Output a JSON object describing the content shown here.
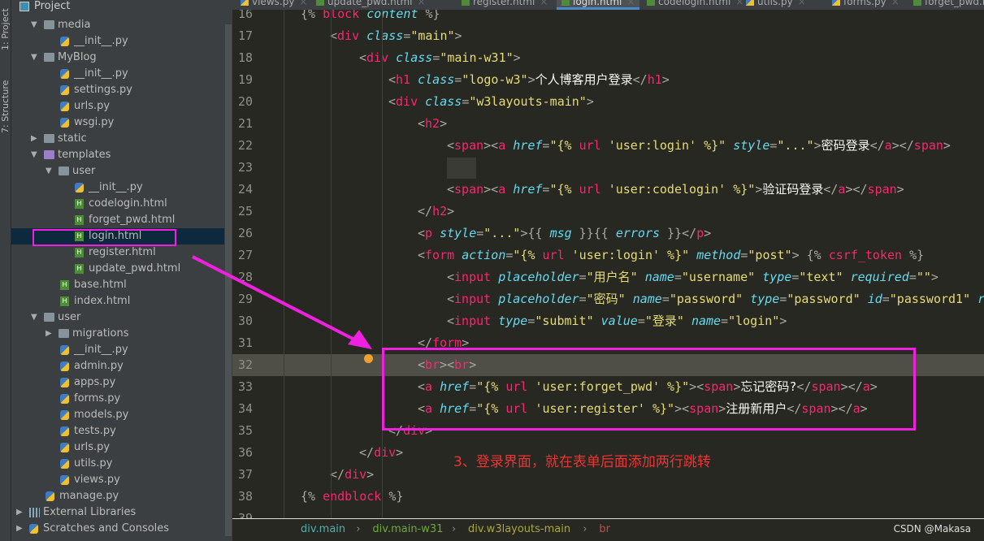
{
  "tool_strip": {
    "project": "1: Project",
    "structure": "7: Structure"
  },
  "sidebar": {
    "title": "Project",
    "items": [
      {
        "label": "media",
        "type": "folder",
        "level": 1,
        "expanded": true
      },
      {
        "label": "__init__.py",
        "type": "py",
        "level": 2
      },
      {
        "label": "MyBlog",
        "type": "folder",
        "level": 1,
        "expanded": true
      },
      {
        "label": "__init__.py",
        "type": "py",
        "level": 2
      },
      {
        "label": "settings.py",
        "type": "py",
        "level": 2
      },
      {
        "label": "urls.py",
        "type": "py",
        "level": 2
      },
      {
        "label": "wsgi.py",
        "type": "py",
        "level": 2
      },
      {
        "label": "static",
        "type": "folder",
        "level": 1,
        "expanded": false
      },
      {
        "label": "templates",
        "type": "folder-purple",
        "level": 1,
        "expanded": true
      },
      {
        "label": "user",
        "type": "folder",
        "level": 2,
        "expanded": true
      },
      {
        "label": "__init__.py",
        "type": "py",
        "level": 3
      },
      {
        "label": "codelogin.html",
        "type": "html",
        "level": 3
      },
      {
        "label": "forget_pwd.html",
        "type": "html",
        "level": 3
      },
      {
        "label": "login.html",
        "type": "html",
        "level": 3,
        "selected": true
      },
      {
        "label": "register.html",
        "type": "html",
        "level": 3
      },
      {
        "label": "update_pwd.html",
        "type": "html",
        "level": 3
      },
      {
        "label": "base.html",
        "type": "html",
        "level": 2
      },
      {
        "label": "index.html",
        "type": "html",
        "level": 2
      },
      {
        "label": "user",
        "type": "folder",
        "level": 1,
        "expanded": true
      },
      {
        "label": "migrations",
        "type": "folder",
        "level": 2,
        "expanded": false
      },
      {
        "label": "__init__.py",
        "type": "py",
        "level": 2
      },
      {
        "label": "admin.py",
        "type": "py",
        "level": 2
      },
      {
        "label": "apps.py",
        "type": "py",
        "level": 2
      },
      {
        "label": "forms.py",
        "type": "py",
        "level": 2
      },
      {
        "label": "models.py",
        "type": "py",
        "level": 2
      },
      {
        "label": "tests.py",
        "type": "py",
        "level": 2
      },
      {
        "label": "urls.py",
        "type": "py",
        "level": 2
      },
      {
        "label": "utils.py",
        "type": "py",
        "level": 2
      },
      {
        "label": "views.py",
        "type": "py",
        "level": 2
      },
      {
        "label": "manage.py",
        "type": "py",
        "level": 1
      },
      {
        "label": "External Libraries",
        "type": "lib",
        "level": 0,
        "expanded": false
      },
      {
        "label": "Scratches and Consoles",
        "type": "scratch",
        "level": 0,
        "expanded": false
      }
    ]
  },
  "tabs": [
    {
      "label": "views.py",
      "type": "py"
    },
    {
      "label": "update_pwd.html",
      "type": "html"
    },
    {
      "label": "register.html",
      "type": "html"
    },
    {
      "label": "login.html",
      "type": "html",
      "active": true
    },
    {
      "label": "codelogin.html",
      "type": "html"
    },
    {
      "label": "utils.py",
      "type": "py"
    },
    {
      "label": "forms.py",
      "type": "py"
    },
    {
      "label": "forget_pwd.htm",
      "type": "html"
    }
  ],
  "code": [
    {
      "n": "16",
      "i": 0,
      "tok": [
        [
          "p",
          "{% "
        ],
        [
          "k",
          "block "
        ],
        [
          "a",
          "content"
        ],
        [
          "p",
          " %}"
        ]
      ]
    },
    {
      "n": "17",
      "i": 1,
      "tok": [
        [
          "p",
          "<"
        ],
        [
          "t",
          "div "
        ],
        [
          "a",
          "class"
        ],
        [
          "p",
          "="
        ],
        [
          "s",
          "\"main\""
        ],
        [
          "p",
          ">"
        ]
      ]
    },
    {
      "n": "18",
      "i": 2,
      "tok": [
        [
          "p",
          "<"
        ],
        [
          "t",
          "div "
        ],
        [
          "a",
          "class"
        ],
        [
          "p",
          "="
        ],
        [
          "s",
          "\"main-w31\""
        ],
        [
          "p",
          ">"
        ]
      ]
    },
    {
      "n": "19",
      "i": 3,
      "tok": [
        [
          "p",
          "<"
        ],
        [
          "t",
          "h1 "
        ],
        [
          "a",
          "class"
        ],
        [
          "p",
          "="
        ],
        [
          "s",
          "\"logo-w3\""
        ],
        [
          "p",
          ">"
        ],
        [
          "x",
          "个人博客用户登录"
        ],
        [
          "p",
          "</"
        ],
        [
          "t",
          "h1"
        ],
        [
          "p",
          ">"
        ]
      ]
    },
    {
      "n": "20",
      "i": 3,
      "tok": [
        [
          "p",
          "<"
        ],
        [
          "t",
          "div "
        ],
        [
          "a",
          "class"
        ],
        [
          "p",
          "="
        ],
        [
          "s",
          "\"w3layouts-main\""
        ],
        [
          "p",
          ">"
        ]
      ]
    },
    {
      "n": "21",
      "i": 4,
      "tok": [
        [
          "p",
          "<"
        ],
        [
          "t",
          "h2"
        ],
        [
          "p",
          ">"
        ]
      ]
    },
    {
      "n": "22",
      "i": 5,
      "tok": [
        [
          "p",
          "<"
        ],
        [
          "t",
          "span"
        ],
        [
          "p",
          "><"
        ],
        [
          "t",
          "a "
        ],
        [
          "a",
          "href"
        ],
        [
          "p",
          "="
        ],
        [
          "s",
          "\"{% "
        ],
        [
          "k",
          "url "
        ],
        [
          "s",
          "'user:login' %}\" "
        ],
        [
          "a",
          "style"
        ],
        [
          "p",
          "="
        ],
        [
          "s",
          "\"...\""
        ],
        [
          "p",
          ">"
        ],
        [
          "x",
          "密码登录"
        ],
        [
          "p",
          "</"
        ],
        [
          "t",
          "a"
        ],
        [
          "p",
          "></"
        ],
        [
          "t",
          "span"
        ],
        [
          "p",
          ">"
        ]
      ]
    },
    {
      "n": "23",
      "i": 5,
      "tok": []
    },
    {
      "n": "24",
      "i": 5,
      "tok": [
        [
          "p",
          "<"
        ],
        [
          "t",
          "span"
        ],
        [
          "p",
          "><"
        ],
        [
          "t",
          "a "
        ],
        [
          "a",
          "href"
        ],
        [
          "p",
          "="
        ],
        [
          "s",
          "\"{% "
        ],
        [
          "k",
          "url "
        ],
        [
          "s",
          "'user:codelogin' %}\""
        ],
        [
          "p",
          ">"
        ],
        [
          "x",
          "验证码登录"
        ],
        [
          "p",
          "</"
        ],
        [
          "t",
          "a"
        ],
        [
          "p",
          "></"
        ],
        [
          "t",
          "span"
        ],
        [
          "p",
          ">"
        ]
      ]
    },
    {
      "n": "25",
      "i": 4,
      "tok": [
        [
          "p",
          "</"
        ],
        [
          "t",
          "h2"
        ],
        [
          "p",
          ">"
        ]
      ]
    },
    {
      "n": "26",
      "i": 4,
      "tok": [
        [
          "p",
          "<"
        ],
        [
          "t",
          "p "
        ],
        [
          "a",
          "style"
        ],
        [
          "p",
          "="
        ],
        [
          "s",
          "\"...\""
        ],
        [
          "p",
          ">{{ "
        ],
        [
          "v",
          "msg"
        ],
        [
          "p",
          " }}{{ "
        ],
        [
          "v",
          "errors"
        ],
        [
          "p",
          " }}</"
        ],
        [
          "t",
          "p"
        ],
        [
          "p",
          ">"
        ]
      ]
    },
    {
      "n": "27",
      "i": 4,
      "tok": [
        [
          "p",
          "<"
        ],
        [
          "t",
          "form "
        ],
        [
          "a",
          "action"
        ],
        [
          "p",
          "="
        ],
        [
          "s",
          "\"{% "
        ],
        [
          "k",
          "url "
        ],
        [
          "s",
          "'user:login' %}\" "
        ],
        [
          "a",
          "method"
        ],
        [
          "p",
          "="
        ],
        [
          "s",
          "\"post\""
        ],
        [
          "p",
          "> {% "
        ],
        [
          "k",
          "csrf_token"
        ],
        [
          "p",
          " %}"
        ]
      ]
    },
    {
      "n": "28",
      "i": 5,
      "tok": [
        [
          "p",
          "<"
        ],
        [
          "t",
          "input "
        ],
        [
          "a",
          "placeholder"
        ],
        [
          "p",
          "="
        ],
        [
          "s",
          "\"用户名\" "
        ],
        [
          "a",
          "name"
        ],
        [
          "p",
          "="
        ],
        [
          "s",
          "\"username\" "
        ],
        [
          "a",
          "type"
        ],
        [
          "p",
          "="
        ],
        [
          "s",
          "\"text\" "
        ],
        [
          "a",
          "required"
        ],
        [
          "p",
          "="
        ],
        [
          "s",
          "\"\""
        ],
        [
          "p",
          ">"
        ]
      ]
    },
    {
      "n": "29",
      "i": 5,
      "tok": [
        [
          "p",
          "<"
        ],
        [
          "t",
          "input "
        ],
        [
          "a",
          "placeholder"
        ],
        [
          "p",
          "="
        ],
        [
          "s",
          "\"密码\" "
        ],
        [
          "a",
          "name"
        ],
        [
          "p",
          "="
        ],
        [
          "s",
          "\"password\" "
        ],
        [
          "a",
          "type"
        ],
        [
          "p",
          "="
        ],
        [
          "s",
          "\"password\" "
        ],
        [
          "a",
          "id"
        ],
        [
          "p",
          "="
        ],
        [
          "s",
          "\"password1\" "
        ],
        [
          "a",
          "r"
        ]
      ]
    },
    {
      "n": "30",
      "i": 5,
      "tok": [
        [
          "p",
          "<"
        ],
        [
          "t",
          "input "
        ],
        [
          "a",
          "type"
        ],
        [
          "p",
          "="
        ],
        [
          "s",
          "\"submit\" "
        ],
        [
          "a",
          "value"
        ],
        [
          "p",
          "="
        ],
        [
          "s",
          "\"登录\" "
        ],
        [
          "a",
          "name"
        ],
        [
          "p",
          "="
        ],
        [
          "s",
          "\"login\""
        ],
        [
          "p",
          ">"
        ]
      ]
    },
    {
      "n": "31",
      "i": 4,
      "tok": [
        [
          "p",
          "</"
        ],
        [
          "t",
          "form"
        ],
        [
          "p",
          ">"
        ]
      ]
    },
    {
      "n": "32",
      "i": 4,
      "hl": true,
      "tok": [
        [
          "p",
          "<"
        ],
        [
          "t",
          "br"
        ],
        [
          "p",
          ">"
        ],
        [
          "p",
          "<"
        ],
        [
          "t",
          "br"
        ],
        [
          "p",
          ">"
        ]
      ]
    },
    {
      "n": "33",
      "i": 4,
      "tok": [
        [
          "p",
          "<"
        ],
        [
          "t",
          "a "
        ],
        [
          "a",
          "href"
        ],
        [
          "p",
          "="
        ],
        [
          "s",
          "\"{% "
        ],
        [
          "k",
          "url "
        ],
        [
          "s",
          "'user:forget_pwd' %}\""
        ],
        [
          "p",
          "><"
        ],
        [
          "t",
          "span"
        ],
        [
          "p",
          ">"
        ],
        [
          "x",
          "忘记密码?"
        ],
        [
          "p",
          "</"
        ],
        [
          "t",
          "span"
        ],
        [
          "p",
          "></"
        ],
        [
          "t",
          "a"
        ],
        [
          "p",
          ">"
        ]
      ]
    },
    {
      "n": "34",
      "i": 4,
      "tok": [
        [
          "p",
          "<"
        ],
        [
          "t",
          "a "
        ],
        [
          "a",
          "href"
        ],
        [
          "p",
          "="
        ],
        [
          "s",
          "\"{% "
        ],
        [
          "k",
          "url "
        ],
        [
          "s",
          "'user:register' %}\""
        ],
        [
          "p",
          "><"
        ],
        [
          "t",
          "span"
        ],
        [
          "p",
          ">"
        ],
        [
          "x",
          "注册新用户"
        ],
        [
          "p",
          "</"
        ],
        [
          "t",
          "span"
        ],
        [
          "p",
          "></"
        ],
        [
          "t",
          "a"
        ],
        [
          "p",
          ">"
        ]
      ]
    },
    {
      "n": "35",
      "i": 3,
      "tok": [
        [
          "p",
          "</"
        ],
        [
          "t",
          "div"
        ],
        [
          "p",
          ">"
        ]
      ]
    },
    {
      "n": "36",
      "i": 2,
      "tok": [
        [
          "p",
          "</"
        ],
        [
          "t",
          "div"
        ],
        [
          "p",
          ">"
        ]
      ]
    },
    {
      "n": "37",
      "i": 1,
      "tok": [
        [
          "p",
          "</"
        ],
        [
          "t",
          "div"
        ],
        [
          "p",
          ">"
        ]
      ]
    },
    {
      "n": "38",
      "i": 0,
      "tok": [
        [
          "p",
          "{% "
        ],
        [
          "k",
          "endblock"
        ],
        [
          "p",
          " %}"
        ]
      ]
    },
    {
      "n": "39",
      "i": 0,
      "tok": []
    }
  ],
  "breadcrumb": [
    {
      "label": "div.main",
      "color": "#4fb0b0"
    },
    {
      "label": "div.main-w31",
      "color": "#6aaa3a"
    },
    {
      "label": "div.w3layouts-main",
      "color": "#a8a83a"
    },
    {
      "label": "br",
      "color": "#c84848"
    }
  ],
  "annotation": {
    "text": "3、登录界面，就在表单后面添加两行跳转",
    "color": "#ee3333",
    "highlight_color": "#f020e0"
  },
  "watermark": "CSDN @Makasa"
}
